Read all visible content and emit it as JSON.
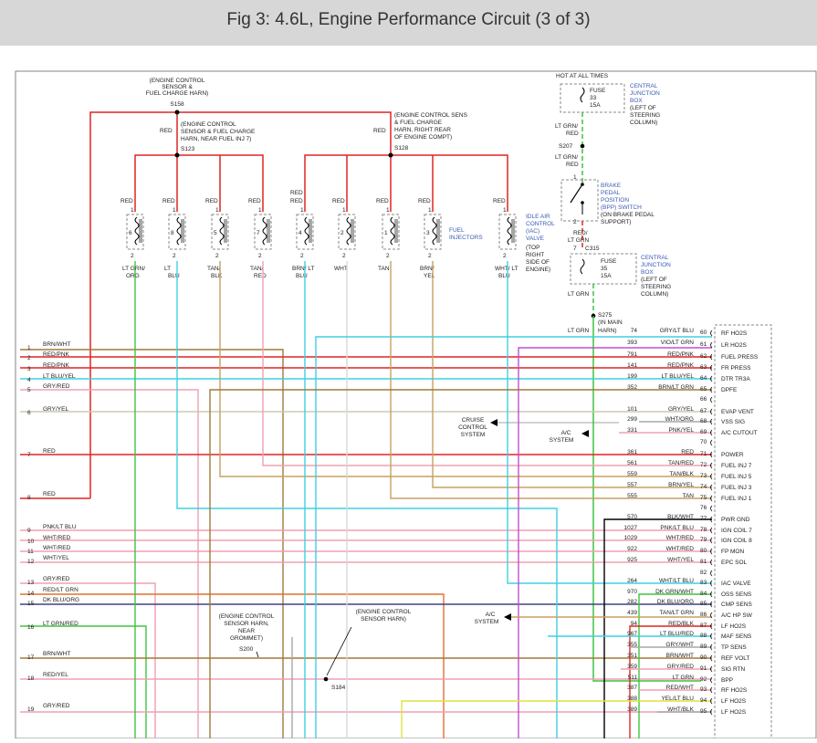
{
  "title": "Fig 3: 4.6L, Engine Performance Circuit (3 of 3)",
  "splices": {
    "s158": [
      "(ENGINE CONTROL",
      "SENSOR &",
      "FUEL CHARGE HARN)",
      "S158"
    ],
    "s123": [
      "(ENGINE CONTROL",
      "SENSOR & FUEL CHARGE",
      "HARN, NEAR FUEL INJ 7)",
      "S123"
    ],
    "s128": [
      "(ENGINE CONTROL SENS",
      "& FUEL CHARGE",
      "HARN, RIGHT REAR",
      "OF ENGINE COMPT)",
      "S128"
    ],
    "s200": [
      "(ENGINE CONTROL",
      "SENSOR HARN,",
      "NEAR",
      "GROMMET)",
      "S200"
    ],
    "s184": [
      "(ENGINE CONTROL",
      "SENSOR HARN)"
    ],
    "s184_label": "S184",
    "s207": "S207",
    "s275": [
      "S275",
      "(IN MAIN",
      "HARN)"
    ]
  },
  "injectors": [
    {
      "num": "6",
      "top": "RED",
      "bottom": "LT GRN/ ORG"
    },
    {
      "num": "8",
      "top": "RED",
      "bottom": "LT BLU"
    },
    {
      "num": "5",
      "top": "RED",
      "bottom": "TAN/ BLK"
    },
    {
      "num": "7",
      "top": "RED",
      "bottom": "TAN/ RED"
    },
    {
      "num": "4",
      "top": "RED",
      "bottom": "BRN/ LT BLU"
    },
    {
      "num": "2",
      "top": "RED",
      "bottom": "WHT"
    },
    {
      "num": "1",
      "top": "RED",
      "bottom": "TAN"
    },
    {
      "num": "3",
      "top": "RED",
      "bottom": "BRN/ YEL"
    },
    {
      "num": "",
      "top": "RED",
      "bottom": "WHT/ LT BLU"
    }
  ],
  "pin1": "1",
  "pin2": "2",
  "wire_red": "RED",
  "fuel_injectors": [
    "FUEL",
    "INJECTORS"
  ],
  "iac": [
    "IDLE AIR",
    "CONTROL",
    "(IAC)",
    "VALVE",
    "(TOP",
    "RIGHT",
    "SIDE OF",
    "ENGINE)"
  ],
  "right_top": {
    "hot": "HOT AT ALL TIMES",
    "fuse33": [
      "FUSE",
      "33",
      "15A"
    ],
    "cjb1": [
      "CENTRAL",
      "JUNCTION",
      "BOX",
      "(LEFT OF",
      "STEERING",
      "COLUMN)"
    ],
    "w1": [
      "LT GRN/",
      "RED"
    ],
    "w2": [
      "LT GRN/",
      "RED"
    ],
    "bpp": [
      "BRAKE",
      "PEDAL",
      "POSITION",
      "(BPP) SWITCH",
      "(ON BRAKE PEDAL",
      "SUPPORT)"
    ],
    "w3": [
      "RED/",
      "LT GRN"
    ],
    "c315": "C315",
    "pin7": "7",
    "fuse35": [
      "FUSE",
      "35",
      "15A"
    ],
    "cjb2": [
      "CENTRAL",
      "JUNCTION",
      "BOX",
      "(LEFT OF",
      "STEERING",
      "COLUMN)"
    ],
    "w4": "LT GRN",
    "w5": "LT GRN"
  },
  "left_wires": [
    {
      "pin": "1",
      "label": "BRN/WHT"
    },
    {
      "pin": "2",
      "label": "RED/PNK"
    },
    {
      "pin": "3",
      "label": "RED/PNK"
    },
    {
      "pin": "4",
      "label": "LT BLU/YEL"
    },
    {
      "pin": "5",
      "label": "GRY/RED"
    },
    {
      "pin": "6",
      "label": "GRY/YEL"
    },
    {
      "pin": "7",
      "label": "RED"
    },
    {
      "pin": "8",
      "label": "RED"
    },
    {
      "pin": "9",
      "label": "PNK/LT BLU"
    },
    {
      "pin": "10",
      "label": "WHT/RED"
    },
    {
      "pin": "11",
      "label": "WHT/RED"
    },
    {
      "pin": "12",
      "label": "WHT/YEL"
    },
    {
      "pin": "13",
      "label": "GRY/RED"
    },
    {
      "pin": "14",
      "label": "RED/LT GRN"
    },
    {
      "pin": "15",
      "label": "DK BLU/ORG"
    },
    {
      "pin": "16",
      "label": "LT GRN/RED"
    },
    {
      "pin": "17",
      "label": "BRN/WHT"
    },
    {
      "pin": "18",
      "label": "RED/YEL"
    },
    {
      "pin": "19",
      "label": "GRY/RED"
    }
  ],
  "pcm_rows": [
    {
      "circ": "74",
      "wire": "GRY/LT BLU",
      "pin": "60",
      "func": "RF HO2S"
    },
    {
      "circ": "393",
      "wire": "VIO/LT GRN",
      "pin": "61",
      "func": "LR HO2S"
    },
    {
      "circ": "791",
      "wire": "RED/PNK",
      "pin": "62",
      "func": "FUEL PRESS"
    },
    {
      "circ": "141",
      "wire": "RED/PNK",
      "pin": "63",
      "func": "FR PRESS"
    },
    {
      "circ": "199",
      "wire": "LT BLU/YEL",
      "pin": "64",
      "func": "DTR TR3A"
    },
    {
      "circ": "352",
      "wire": "BRN/LT GRN",
      "pin": "65",
      "func": "DPFE"
    },
    {
      "circ": "",
      "wire": "",
      "pin": "66",
      "func": ""
    },
    {
      "circ": "101",
      "wire": "GRY/YEL",
      "pin": "67",
      "func": "EVAP VENT"
    },
    {
      "circ": "299",
      "wire": "WHT/ORG",
      "pin": "68",
      "func": "VSS SIG"
    },
    {
      "circ": "331",
      "wire": "PNK/YEL",
      "pin": "69",
      "func": "A/C CUTOUT"
    },
    {
      "circ": "",
      "wire": "",
      "pin": "70",
      "func": ""
    },
    {
      "circ": "361",
      "wire": "RED",
      "pin": "71",
      "func": "POWER"
    },
    {
      "circ": "561",
      "wire": "TAN/RED",
      "pin": "72",
      "func": "FUEL INJ 7"
    },
    {
      "circ": "559",
      "wire": "TAN/BLK",
      "pin": "73",
      "func": "FUEL INJ 5"
    },
    {
      "circ": "557",
      "wire": "BRN/YEL",
      "pin": "74",
      "func": "FUEL INJ 3"
    },
    {
      "circ": "555",
      "wire": "TAN",
      "pin": "75",
      "func": "FUEL INJ 1"
    },
    {
      "circ": "",
      "wire": "",
      "pin": "76",
      "func": ""
    },
    {
      "circ": "570",
      "wire": "BLK/WHT",
      "pin": "77",
      "func": "PWR GND"
    },
    {
      "circ": "1027",
      "wire": "PNK/LT BLU",
      "pin": "78",
      "func": "IGN COIL 7"
    },
    {
      "circ": "1029",
      "wire": "WHT/RED",
      "pin": "79",
      "func": "IGN COIL 8"
    },
    {
      "circ": "922",
      "wire": "WHT/RED",
      "pin": "80",
      "func": "FP MON"
    },
    {
      "circ": "925",
      "wire": "WHT/YEL",
      "pin": "81",
      "func": "EPC SOL"
    },
    {
      "circ": "",
      "wire": "",
      "pin": "82",
      "func": ""
    },
    {
      "circ": "264",
      "wire": "WHT/LT BLU",
      "pin": "83",
      "func": "IAC VALVE"
    },
    {
      "circ": "970",
      "wire": "DK GRN/WHT",
      "pin": "84",
      "func": "OSS SENS"
    },
    {
      "circ": "282",
      "wire": "DK BLU/ORG",
      "pin": "85",
      "func": "CMP SENS"
    },
    {
      "circ": "439",
      "wire": "TAN/LT GRN",
      "pin": "86",
      "func": "A/C HP SW"
    },
    {
      "circ": "94",
      "wire": "RED/BLK",
      "pin": "87",
      "func": "LF HO2S"
    },
    {
      "circ": "967",
      "wire": "LT BLU/RED",
      "pin": "88",
      "func": "MAF SENS"
    },
    {
      "circ": "355",
      "wire": "GRY/WHT",
      "pin": "89",
      "func": "TP SENS"
    },
    {
      "circ": "351",
      "wire": "BRN/WHT",
      "pin": "90",
      "func": "REF VOLT"
    },
    {
      "circ": "359",
      "wire": "GRY/RED",
      "pin": "91",
      "func": "SIG RTN"
    },
    {
      "circ": "511",
      "wire": "LT GRN",
      "pin": "92",
      "func": "BPP"
    },
    {
      "circ": "387",
      "wire": "RED/WHT",
      "pin": "93",
      "func": "RF HO2S"
    },
    {
      "circ": "388",
      "wire": "YEL/LT BLU",
      "pin": "94",
      "func": "LF HO2S"
    },
    {
      "circ": "389",
      "wire": "WHT/BLK",
      "pin": "95",
      "func": "LF HO2S"
    }
  ],
  "cruise": [
    "CRUISE",
    "CONTROL",
    "SYSTEM"
  ],
  "ac1": [
    "A/C",
    "SYSTEM"
  ],
  "ac2": [
    "A/C",
    "SYSTEM"
  ],
  "colors": {
    "red": "#e02424",
    "brown": "#a07a3a",
    "lightblue": "#3fd0e0",
    "pink": "#f0a0b0",
    "gray": "#a8a8a8",
    "green": "#3ec43e",
    "violet": "#c050d0",
    "tan": "#c8a060",
    "darkblue": "#404080",
    "yellow": "#e0e040",
    "orange": "#e07030",
    "black": "#000000",
    "header_bg": "#d7d7d7",
    "label_blue": "#3b5bb5"
  }
}
